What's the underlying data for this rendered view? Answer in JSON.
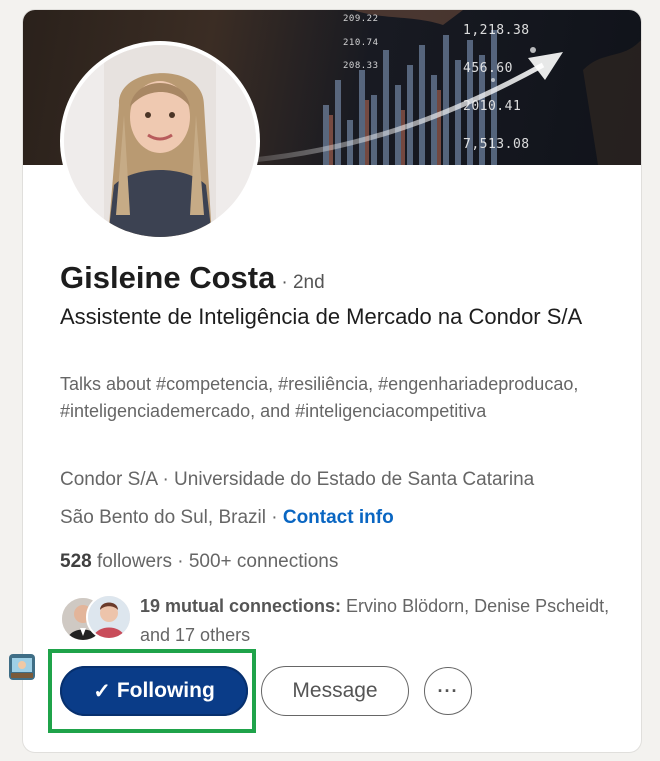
{
  "banner": {
    "tickers": [
      "209.22",
      "210.74",
      "208.33",
      "1,218.38",
      "456.60",
      "2010.41",
      "7,513.08"
    ]
  },
  "profile": {
    "name": "Gisleine Costa",
    "degree": "· 2nd",
    "headline": "Assistente de Inteligência de Mercado na Condor S/A",
    "talks_about": "Talks about #competencia, #resiliência, #engenhariadeproducao, #inteligenciademercado, and #inteligenciacompetitiva",
    "company_line": "Condor S/A · Universidade do Estado de Santa Catarina",
    "location": "São Bento do Sul, Brazil ·",
    "contact_info": "Contact info",
    "followers_count": "528",
    "followers_label": "followers",
    "connections": "· 500+ connections",
    "mutual_bold": "19 mutual connections:",
    "mutual_rest": " Ervino Blödorn, Denise Pscheidt, and 17 others"
  },
  "actions": {
    "following_check": "✓",
    "following_label": "Following",
    "message_label": "Message",
    "more_label": "···"
  }
}
